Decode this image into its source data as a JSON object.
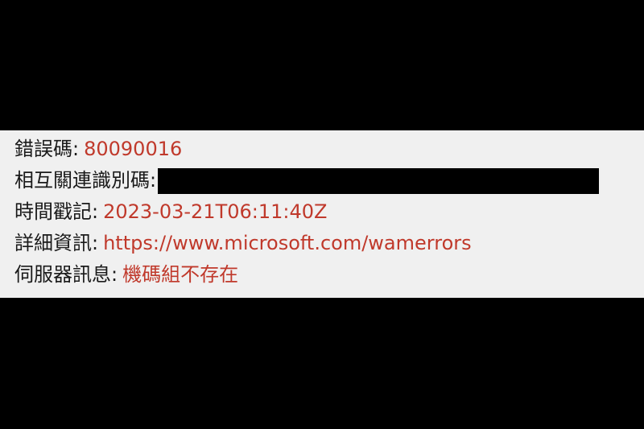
{
  "colors": {
    "background": "#000000",
    "panel": "#f0f0f0",
    "label": "#1a1a1a",
    "value": "#c0392b"
  },
  "rows": [
    {
      "label": "錯誤碼:",
      "value": "80090016"
    },
    {
      "label": "相互關連識別碼:",
      "value": ""
    },
    {
      "label": "時間戳記:",
      "value": "2023-03-21T06:11:40Z"
    },
    {
      "label": "詳細資訊:",
      "value": "https://www.microsoft.com/wamerrors"
    },
    {
      "label": "伺服器訊息:",
      "value": "機碼組不存在"
    }
  ]
}
